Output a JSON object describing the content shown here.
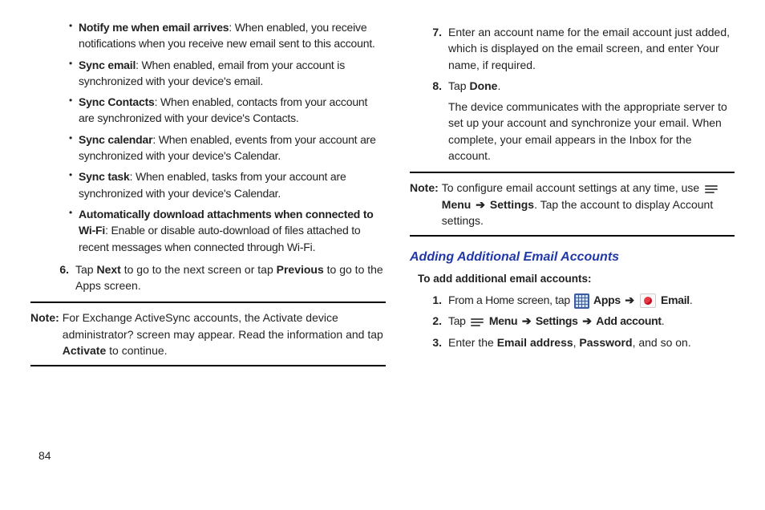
{
  "left": {
    "bullets": [
      {
        "title": "Notify me when email arrives",
        "desc": ": When enabled, you receive notifications when you receive new email sent to this account."
      },
      {
        "title": "Sync email",
        "desc": ": When enabled, email from your account is synchronized with your device's email."
      },
      {
        "title": "Sync Contacts",
        "desc": ": When enabled, contacts from your account are synchronized with your device's Contacts."
      },
      {
        "title": "Sync calendar",
        "desc": ": When enabled, events from your account are synchronized with your device's Calendar."
      },
      {
        "title": "Sync task",
        "desc": ": When enabled, tasks from your account are synchronized with your device's Calendar."
      },
      {
        "title": "Automatically download attachments when connected to Wi-Fi",
        "desc": ": Enable or disable auto-download of files attached to recent messages when connected through Wi-Fi."
      }
    ],
    "step6": {
      "num": "6.",
      "pre": "Tap ",
      "b1": "Next",
      "mid": " to go to the next screen or tap ",
      "b2": "Previous",
      "post": " to go to the Apps screen."
    },
    "note": {
      "label": "Note:",
      "pre": "For Exchange ActiveSync accounts, the Activate device administrator? screen may appear. Read the information and tap ",
      "b": "Activate",
      "post": " to continue."
    }
  },
  "right": {
    "step7": {
      "num": "7.",
      "text": "Enter an account name for the email account just added, which is displayed on the email screen, and enter Your name, if required."
    },
    "step8": {
      "num": "8.",
      "pre": "Tap ",
      "b": "Done",
      "post": ".",
      "para": "The device communicates with the appropriate server to set up your account and synchronize your email. When complete, your email appears in the Inbox for the account."
    },
    "note": {
      "label": "Note:",
      "pre": "To configure email account settings at any time, use ",
      "menu": "Menu",
      "arrow": "➔",
      "settings": "Settings",
      "post": ". Tap the account to display Account settings."
    },
    "heading": "Adding Additional Email Accounts",
    "subhead": "To add additional email accounts:",
    "s1": {
      "num": "1.",
      "pre": "From a Home screen, tap ",
      "apps": "Apps",
      "arrow": "➔",
      "email": "Email",
      "post": "."
    },
    "s2": {
      "num": "2.",
      "pre": "Tap ",
      "menu": "Menu",
      "arrow": "➔",
      "settings": "Settings",
      "arrow2": "➔",
      "add": "Add account",
      "post": "."
    },
    "s3": {
      "num": "3.",
      "pre": "Enter the ",
      "b1": "Email address",
      "mid": ", ",
      "b2": "Password",
      "post": ", and so on."
    }
  },
  "pageNumber": "84"
}
